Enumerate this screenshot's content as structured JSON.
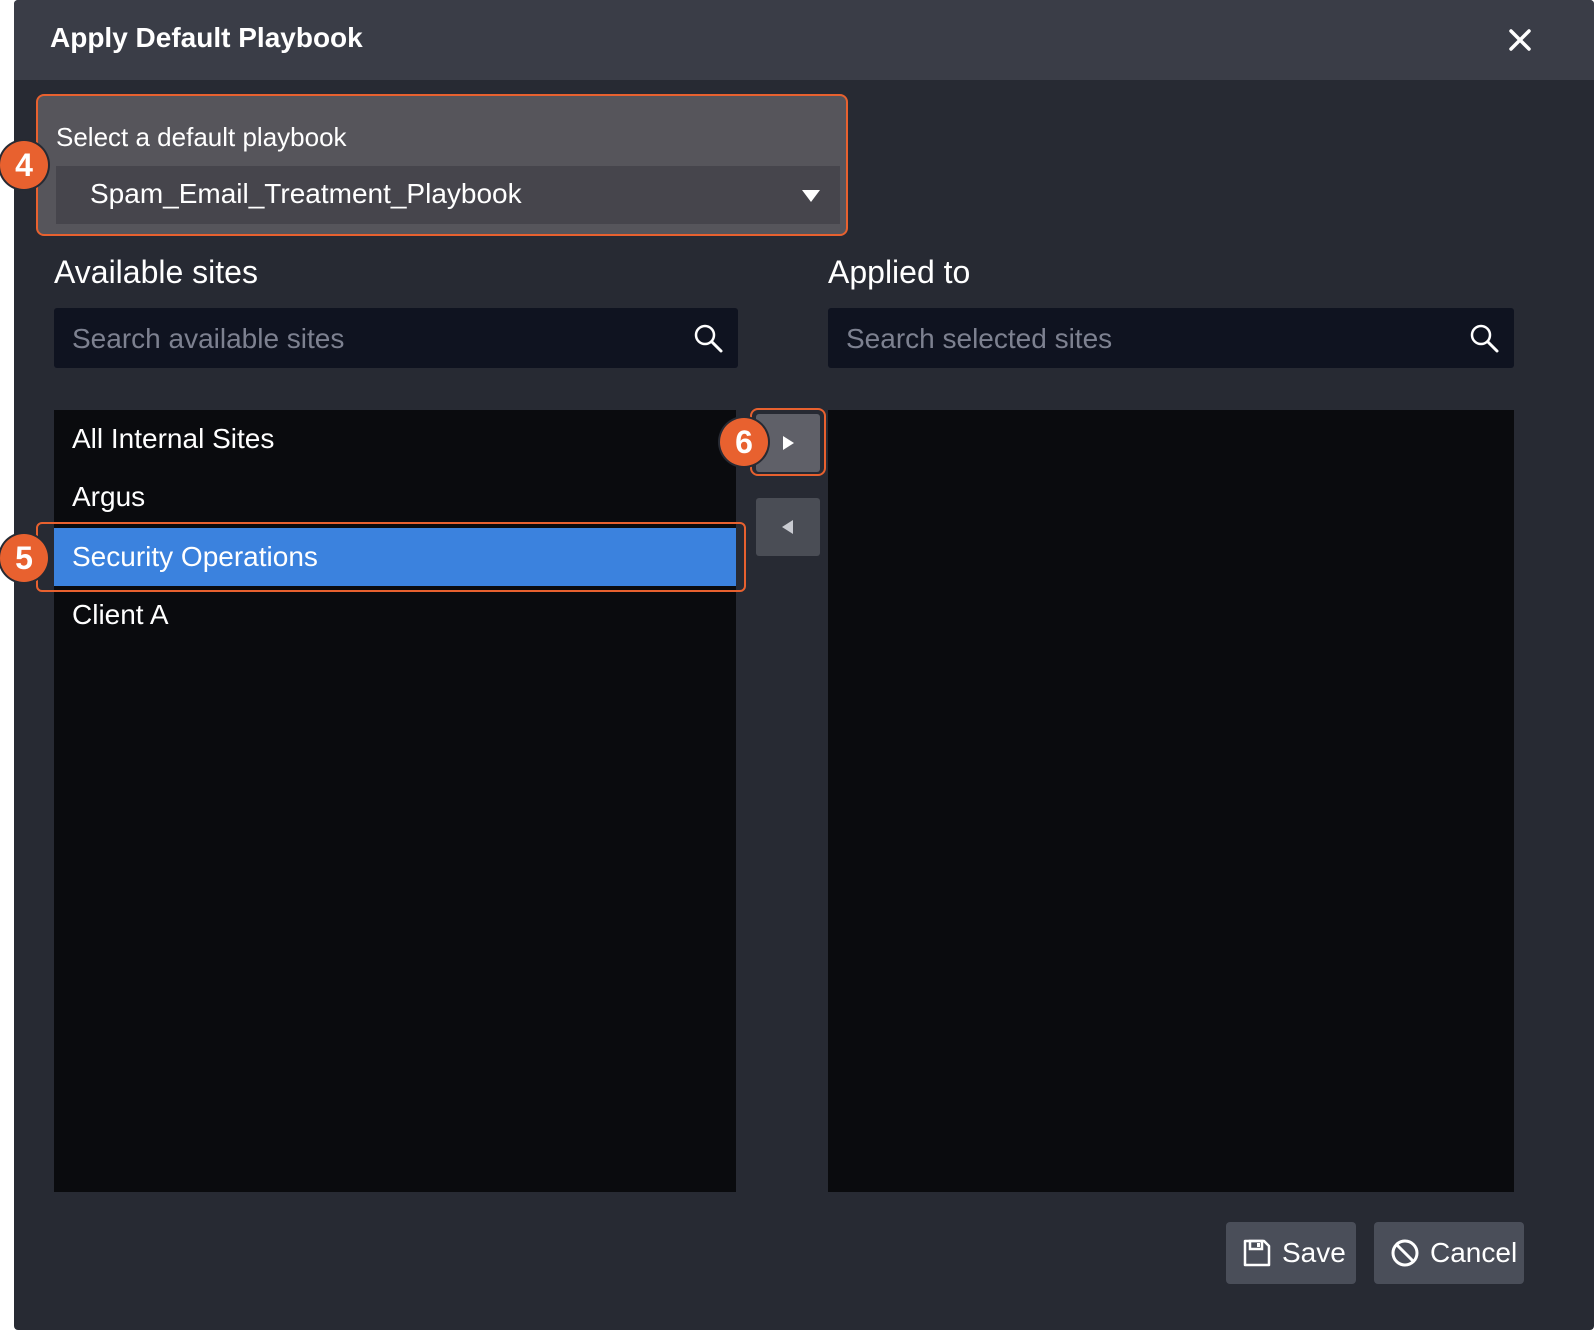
{
  "dialog": {
    "title": "Apply Default Playbook",
    "close_icon": "close-icon"
  },
  "playbook": {
    "label": "Select a default playbook",
    "selected": "Spam_Email_Treatment_Playbook",
    "caret_icon": "caret-down-icon"
  },
  "available": {
    "title": "Available sites",
    "search_placeholder": "Search available sites",
    "items": [
      {
        "label": "All Internal Sites",
        "selected": false
      },
      {
        "label": "Argus",
        "selected": false
      },
      {
        "label": "Security Operations",
        "selected": true
      },
      {
        "label": "Client A",
        "selected": false
      }
    ]
  },
  "applied": {
    "title": "Applied to",
    "search_placeholder": "Search selected sites",
    "items": []
  },
  "transfer": {
    "add_icon": "arrow-right-icon",
    "remove_icon": "arrow-left-icon"
  },
  "callouts": {
    "step4": "4",
    "step5": "5",
    "step6": "6"
  },
  "footer": {
    "save_label": "Save",
    "cancel_label": "Cancel",
    "save_icon": "save-icon",
    "cancel_icon": "cancel-icon"
  },
  "colors": {
    "accent": "#e8612f",
    "selection": "#3b82de",
    "dialog_bg": "#272a33",
    "titlebar_bg": "#3a3d47"
  }
}
